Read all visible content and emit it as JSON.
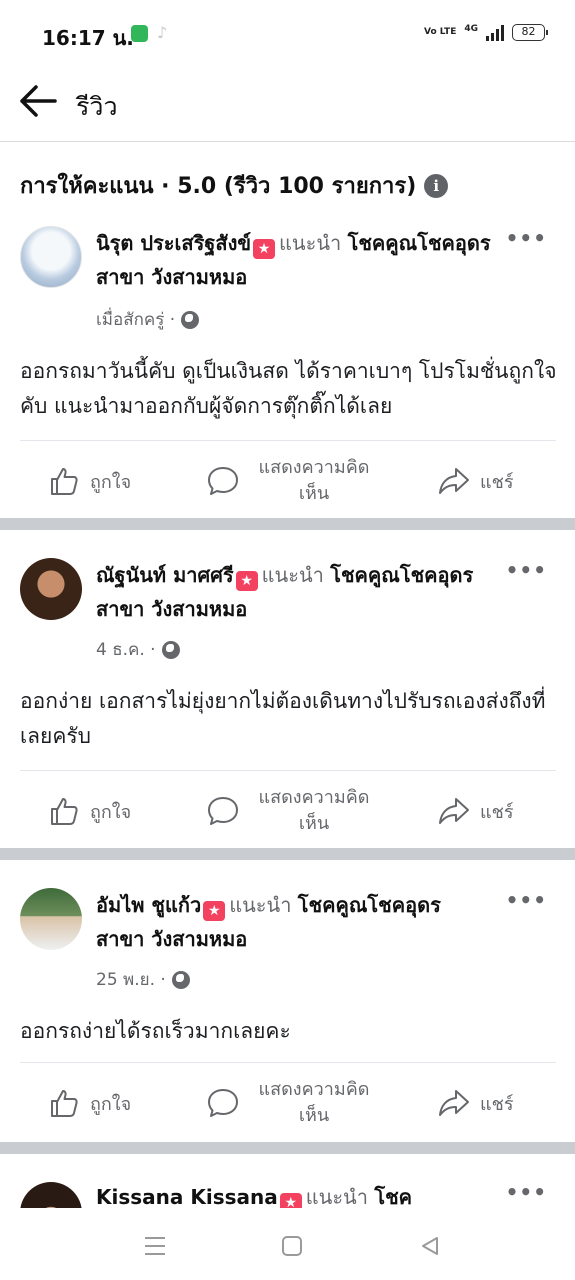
{
  "status_bar": {
    "time": "16:17 น.",
    "network": "4G",
    "volte": "Vo LTE",
    "battery": "82"
  },
  "header": {
    "title": "รีวิว"
  },
  "rating": {
    "text": "การให้คะแนน · 5.0 (รีวิว 100 รายการ)"
  },
  "actions": {
    "like": "ถูกใจ",
    "comment_line1": "แสดงความคิด",
    "comment_line2": "เห็น",
    "share": "แชร์"
  },
  "reviews": [
    {
      "name": "นิรุต ประเสริฐสังข์",
      "recommends": "แนะนำ",
      "page": "โชคคูณโชคอุดร สาขา วังสามหมอ",
      "time": "เมื่อสักครู่ ·",
      "text": "ออกรถมาวันนี้คับ ดูเป็นเงินสด ได้ราคาเบาๆ โปรโมชั่นถูกใจคับ แนะนำมาออกกับผู้จัดการตุ๊กติ๊กได้เลย"
    },
    {
      "name": "ณัฐนันท์ มาศศรี",
      "recommends": "แนะนำ",
      "page": "โชคคูณโชคอุดร สาขา วังสามหมอ",
      "time": "4 ธ.ค. ·",
      "text": "ออกง่าย เอกสารไม่ยุ่งยากไม่ต้องเดินทางไปรับรถเองส่งถึงที่เลยครับ"
    },
    {
      "name": "อัมไพ ชูแก้ว",
      "recommends": "แนะนำ",
      "page": "โชคคูณโชคอุดร สาขา วังสามหมอ",
      "time": "25 พ.ย. ·",
      "text": "ออกรถง่ายได้รถเร็วมากเลยคะ"
    },
    {
      "name": "Kissana Kissana",
      "recommends": "แนะนำ",
      "page": "โชค"
    }
  ]
}
